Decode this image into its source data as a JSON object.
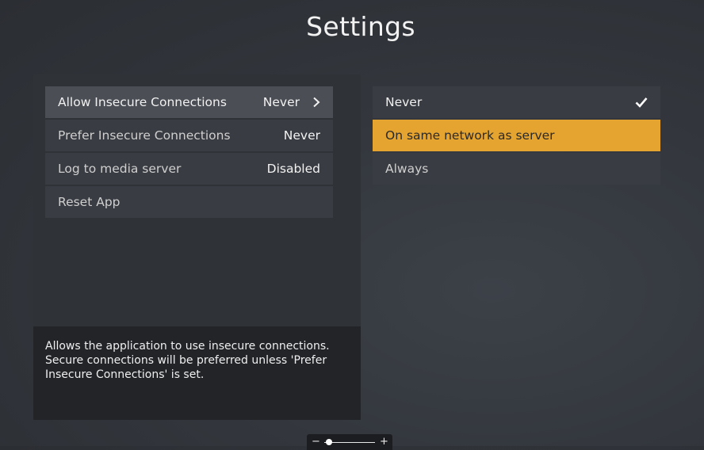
{
  "page": {
    "title": "Settings"
  },
  "settings": [
    {
      "label": "Allow Insecure Connections",
      "value": "Never",
      "active": true
    },
    {
      "label": "Prefer Insecure Connections",
      "value": "Never",
      "active": false
    },
    {
      "label": "Log to media server",
      "value": "Disabled",
      "active": false
    },
    {
      "label": "Reset App",
      "value": "",
      "active": false
    }
  ],
  "description": {
    "lines": [
      "Allows the application to use insecure connections.",
      "Secure connections will be preferred unless 'Prefer",
      "Insecure Connections' is set."
    ]
  },
  "options": [
    {
      "label": "Never",
      "selected": true,
      "focused": false
    },
    {
      "label": "On same network as server",
      "selected": false,
      "focused": true
    },
    {
      "label": "Always",
      "selected": false,
      "focused": false
    }
  ],
  "zoom": {
    "minus": "−",
    "plus": "+",
    "level": 0.1
  },
  "colors": {
    "accent": "#e5a32f",
    "background": "#33373d",
    "row": "#393c42",
    "active_row": "#4b4e55"
  },
  "icons": {
    "chevron": "chevron-right-icon",
    "check": "checkmark-icon"
  }
}
